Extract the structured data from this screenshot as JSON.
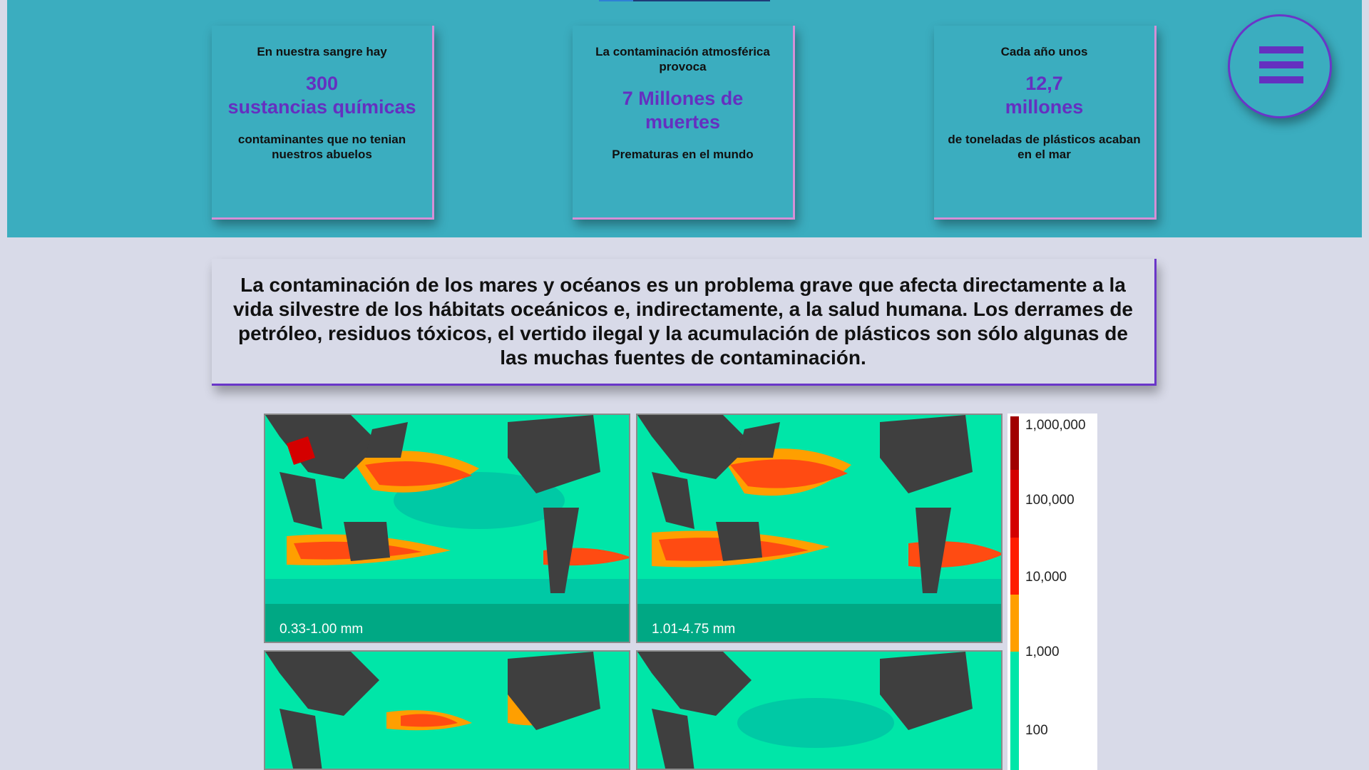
{
  "cards": [
    {
      "intro": "En nuestra sangre hay",
      "big_line1": "300",
      "big_line2": "sustancias químicas",
      "outro": "contaminantes que no tenian nuestros abuelos"
    },
    {
      "intro": "La contaminación atmosférica provoca",
      "big_line1": "7 Millones de",
      "big_line2": "muertes",
      "outro": "Prematuras en el mundo"
    },
    {
      "intro": "Cada año unos",
      "big_line1": "12,7",
      "big_line2": "millones",
      "outro": "de toneladas de plásticos acaban en el mar"
    }
  ],
  "menu": {
    "icon": "hamburger-menu-icon"
  },
  "intro_text": "La contaminación de los mares y océanos es un problema grave que afecta directamente a la vida silvestre de los hábitats oceánicos e, indirectamente, a la salud humana. Los derrames de petróleo, residuos tóxicos, el vertido ilegal y la acumulación de plásticos son sólo algunas de las muchas fuentes de contaminación.",
  "figure": {
    "maps": [
      {
        "label": "0.33-1.00 mm"
      },
      {
        "label": "1.01-4.75 mm"
      },
      {
        "label": ""
      },
      {
        "label": ""
      }
    ],
    "colorbar_ticks": [
      "1,000,000",
      "100,000",
      "10,000",
      "1,000",
      "100"
    ],
    "colors": {
      "land": "#3f3f3f",
      "ocean_low": "#00c9a5",
      "ocean_mid": "#00e6a8",
      "orange": "#ff9f00",
      "red_orange": "#ff4b12",
      "red": "#d40000",
      "dark_red": "#a00000"
    }
  },
  "colors": {
    "band": "#3badbf",
    "accent": "#6530c0",
    "page_bg": "#d8dae8",
    "card_border": "#d58fd6"
  }
}
